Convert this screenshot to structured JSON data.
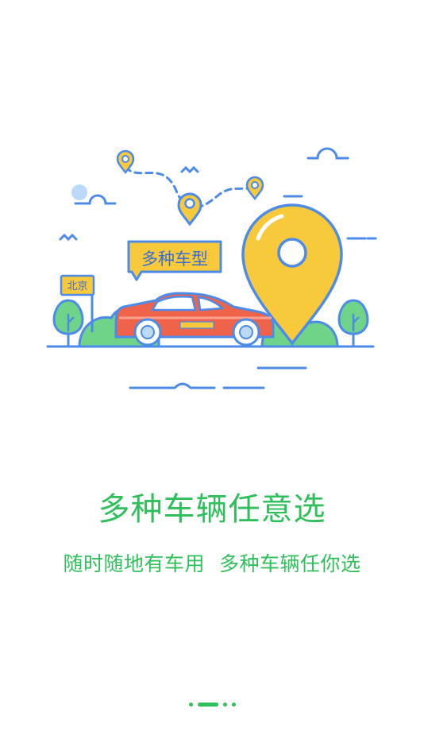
{
  "illustration": {
    "bubble_text": "多种车型",
    "city_sign": "北京"
  },
  "headline": "多种车辆任意选",
  "subline": {
    "part1": "随时随地有车用",
    "part2": "多种车辆任你选"
  },
  "pager": {
    "active_index": 1,
    "count": 4
  },
  "colors": {
    "brand_green": "#2fbf5b",
    "pin_yellow": "#f9c93c",
    "line_blue": "#4d8be8",
    "car_red": "#f0634b",
    "tree_green": "#6fd38a"
  }
}
